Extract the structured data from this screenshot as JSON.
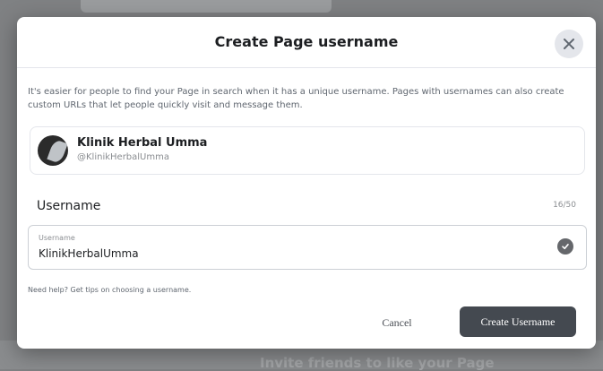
{
  "background": {
    "invite_text": "Invite friends to like your Page"
  },
  "dialog": {
    "title": "Create Page username",
    "close_icon": "close-icon",
    "intro": "It's easier for people to find your Page in search when it has a unique username. Pages with usernames can also create custom URLs that let people quickly visit and message them.",
    "page": {
      "name": "Klinik Herbal Umma",
      "handle": "@KlinikHerbalUmma"
    },
    "username_section": {
      "label": "Username",
      "counter": "16/50",
      "input_caption": "Username",
      "input_value": "KlinikHerbalUmma",
      "status_icon": "check-circle-icon"
    },
    "help_text": "Need help? Get tips on choosing a username.",
    "buttons": {
      "cancel": "Cancel",
      "create": "Create Username"
    }
  },
  "colors": {
    "overlay": "#7f8183",
    "primary_button": "#444950",
    "text": "#1c1e21",
    "muted": "#8a8d91"
  }
}
